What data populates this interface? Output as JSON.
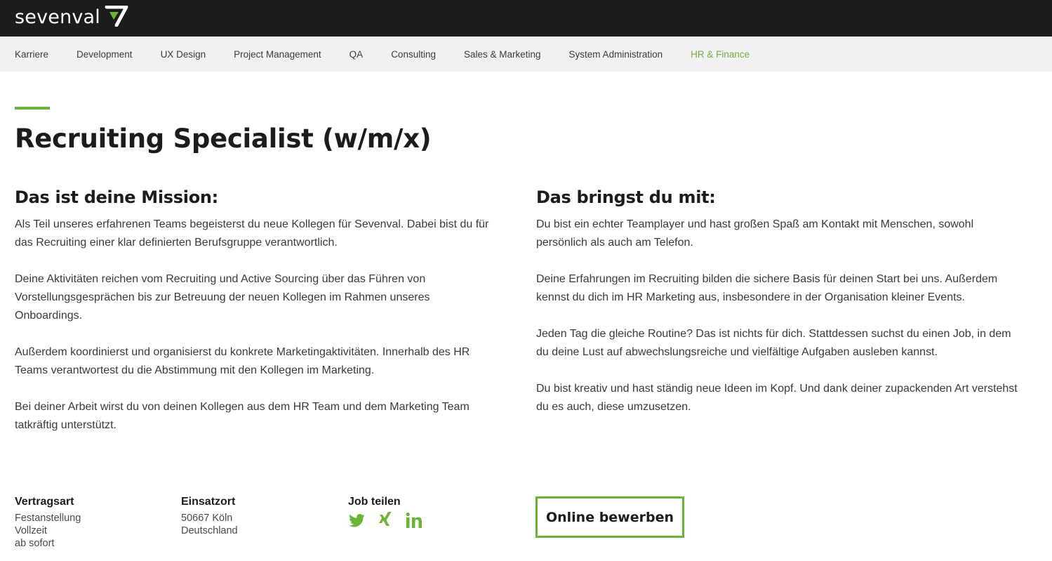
{
  "brand": {
    "name": "sevenval",
    "accent_color": "#69b636",
    "topbar_color": "#1c1c1c"
  },
  "nav": {
    "items": [
      {
        "label": "Karriere",
        "active": false
      },
      {
        "label": "Development",
        "active": false
      },
      {
        "label": "UX Design",
        "active": false
      },
      {
        "label": "Project Management",
        "active": false
      },
      {
        "label": "QA",
        "active": false
      },
      {
        "label": "Consulting",
        "active": false
      },
      {
        "label": "Sales & Marketing",
        "active": false
      },
      {
        "label": "System Administration",
        "active": false
      },
      {
        "label": "HR & Finance",
        "active": true
      }
    ]
  },
  "job": {
    "title": "Recruiting Specialist (w/m/x)",
    "mission": {
      "heading": "Das ist deine Mission:",
      "paragraphs": [
        "Als Teil unseres erfahrenen Teams begeisterst du neue Kollegen für Sevenval. Dabei bist du für das Recruiting einer klar definierten Berufsgruppe verantwortlich.",
        "Deine Aktivitäten reichen vom Recruiting und Active Sourcing über das Führen von Vorstellungsgesprächen bis zur Betreuung der neuen Kollegen im Rahmen unseres Onboardings.",
        "Außerdem koordinierst und organisierst du konkrete Marketingaktivitäten. Innerhalb des HR Teams verantwortest du die Abstimmung mit den Kollegen im Marketing.",
        "Bei deiner Arbeit wirst du von deinen Kollegen aus dem HR Team und dem Marketing Team tatkräftig unterstützt."
      ]
    },
    "requirements": {
      "heading": "Das bringst du mit:",
      "paragraphs": [
        "Du bist ein echter Teamplayer und hast großen Spaß am Kontakt mit Menschen, sowohl persönlich als auch am Telefon.",
        "Deine Erfahrungen im Recruiting bilden die sichere Basis für deinen Start bei uns. Außerdem kennst du dich im HR Marketing aus, insbesondere in der Organisation kleiner Events.",
        "Jeden Tag die gleiche Routine? Das ist nichts für dich. Stattdessen suchst du einen Job, in dem du deine Lust auf abwechslungsreiche und vielfältige Aufgaben ausleben kannst.",
        "Du bist kreativ und hast ständig neue Ideen im Kopf. Und dank deiner zupackenden Art verstehst du es auch, diese umzusetzen."
      ]
    },
    "contract": {
      "heading": "Vertragsart",
      "lines": [
        "Festanstellung",
        "Vollzeit",
        "ab sofort"
      ]
    },
    "location": {
      "heading": "Einsatzort",
      "lines": [
        "50667 Köln",
        "Deutschland"
      ]
    },
    "share": {
      "heading": "Job teilen",
      "icons": [
        "twitter-icon",
        "xing-icon",
        "linkedin-icon"
      ]
    },
    "apply_label": "Online bewerben"
  }
}
